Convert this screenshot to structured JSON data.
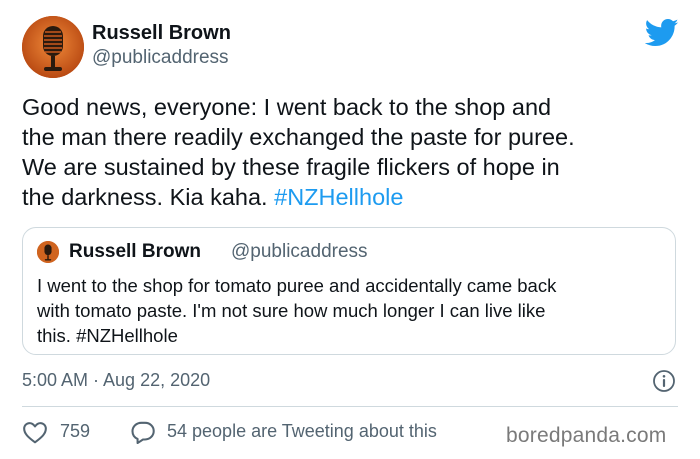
{
  "author": {
    "name": "Russell Brown",
    "handle": "@publicaddress"
  },
  "tweet": {
    "lines": [
      "Good news, everyone: I went back to the shop and",
      "the man there readily exchanged the paste for puree.",
      "We are sustained by these fragile flickers of hope in",
      "the darkness. Kia kaha. "
    ],
    "hashtag": "#NZHellhole"
  },
  "quoted_tweet": {
    "name": "Russell Brown",
    "handle": "@publicaddress",
    "lines": [
      "I went to the shop for tomato puree and accidentally came back",
      "with tomato paste. I'm not sure how much longer I can live like",
      "this. #NZHellhole"
    ]
  },
  "meta": {
    "timestamp": "5:00 AM · Aug 22, 2020"
  },
  "actions": {
    "like_count": "759",
    "reply_text": "54 people are Tweeting about this"
  },
  "watermark": "boredpanda.com",
  "colors": {
    "link": "#1d9bf0",
    "secondary_text": "#536471",
    "border": "#cfd9de",
    "avatar_bg": "#c9591d"
  },
  "icons": [
    "twitter-bird-icon",
    "microphone-avatar",
    "info-icon",
    "heart-icon",
    "speech-bubble-icon"
  ]
}
